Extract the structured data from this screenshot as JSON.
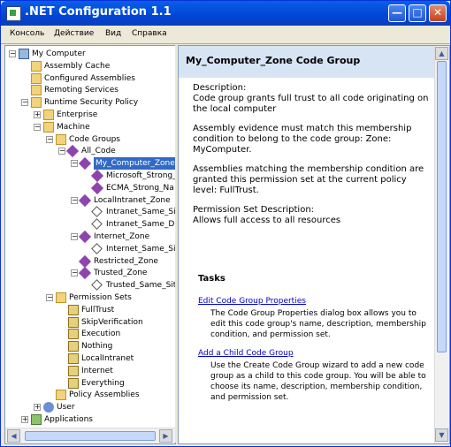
{
  "window": {
    "title": ".NET Configuration 1.1"
  },
  "menubar": {
    "items": [
      "Консоль",
      "Действие",
      "Вид",
      "Справка"
    ]
  },
  "tree": [
    {
      "label": "My Computer",
      "depth": 0,
      "icon": "computer-icon",
      "expander": "-"
    },
    {
      "label": "Assembly Cache",
      "depth": 1,
      "icon": "folder-icon",
      "expander": ""
    },
    {
      "label": "Configured Assemblies",
      "depth": 1,
      "icon": "folder-icon",
      "expander": ""
    },
    {
      "label": "Remoting Services",
      "depth": 1,
      "icon": "folder-icon",
      "expander": ""
    },
    {
      "label": "Runtime Security Policy",
      "depth": 1,
      "icon": "folder-icon",
      "expander": "-"
    },
    {
      "label": "Enterprise",
      "depth": 2,
      "icon": "folder-icon",
      "expander": "+"
    },
    {
      "label": "Machine",
      "depth": 2,
      "icon": "folder-icon",
      "expander": "-"
    },
    {
      "label": "Code Groups",
      "depth": 3,
      "icon": "folder-icon",
      "expander": "-"
    },
    {
      "label": "All_Code",
      "depth": 4,
      "icon": "code-group-icon",
      "expander": "-"
    },
    {
      "label": "My_Computer_Zone",
      "depth": 5,
      "icon": "code-group-icon",
      "expander": "-",
      "selected": true
    },
    {
      "label": "Microsoft_Strong_",
      "depth": 6,
      "icon": "code-group-icon",
      "expander": ""
    },
    {
      "label": "ECMA_Strong_Na",
      "depth": 6,
      "icon": "code-group-icon",
      "expander": ""
    },
    {
      "label": "LocalIntranet_Zone",
      "depth": 5,
      "icon": "code-group-icon",
      "expander": "-"
    },
    {
      "label": "Intranet_Same_Si",
      "depth": 6,
      "icon": "condition-icon",
      "expander": ""
    },
    {
      "label": "Intranet_Same_D",
      "depth": 6,
      "icon": "condition-icon",
      "expander": ""
    },
    {
      "label": "Internet_Zone",
      "depth": 5,
      "icon": "code-group-icon",
      "expander": "-"
    },
    {
      "label": "Internet_Same_Si",
      "depth": 6,
      "icon": "condition-icon",
      "expander": ""
    },
    {
      "label": "Restricted_Zone",
      "depth": 5,
      "icon": "code-group-icon",
      "expander": ""
    },
    {
      "label": "Trusted_Zone",
      "depth": 5,
      "icon": "code-group-icon",
      "expander": "-"
    },
    {
      "label": "Trusted_Same_Sit",
      "depth": 6,
      "icon": "condition-icon",
      "expander": ""
    },
    {
      "label": "Permission Sets",
      "depth": 3,
      "icon": "folder-icon",
      "expander": "-"
    },
    {
      "label": "FullTrust",
      "depth": 4,
      "icon": "permission-set-icon",
      "expander": ""
    },
    {
      "label": "SkipVerification",
      "depth": 4,
      "icon": "permission-set-icon",
      "expander": ""
    },
    {
      "label": "Execution",
      "depth": 4,
      "icon": "permission-set-icon",
      "expander": ""
    },
    {
      "label": "Nothing",
      "depth": 4,
      "icon": "permission-set-icon",
      "expander": ""
    },
    {
      "label": "LocalIntranet",
      "depth": 4,
      "icon": "permission-set-icon",
      "expander": ""
    },
    {
      "label": "Internet",
      "depth": 4,
      "icon": "permission-set-icon",
      "expander": ""
    },
    {
      "label": "Everything",
      "depth": 4,
      "icon": "permission-set-icon",
      "expander": ""
    },
    {
      "label": "Policy Assemblies",
      "depth": 3,
      "icon": "folder-icon",
      "expander": ""
    },
    {
      "label": "User",
      "depth": 2,
      "icon": "user-icon",
      "expander": "+"
    },
    {
      "label": "Applications",
      "depth": 1,
      "icon": "application-icon",
      "expander": "+"
    }
  ],
  "detail": {
    "title": "My_Computer_Zone Code Group",
    "description_label": "Description:",
    "description_text": "Code group grants full trust to all code originating on the local computer",
    "membership_text": "Assembly evidence must match this membership condition to belong to the code group: Zone: MyComputer.",
    "permission_text": "Assemblies matching the membership condition are granted this permission set at the current policy level: FullTrust.",
    "permset_desc_label": "Permission Set Description:",
    "permset_desc_text": "Allows full access to all resources"
  },
  "tasks": {
    "title": "Tasks",
    "items": [
      {
        "link": "Edit Code Group Properties",
        "desc": "The Code Group Properties dialog box allows you to edit this code group's name, description, membership condition, and permission set."
      },
      {
        "link": "Add a Child Code Group",
        "desc": "Use the Create Code Group wizard to add a new code group as a child to this code group. You will be able to choose its name, description, membership condition, and permission set."
      }
    ]
  }
}
